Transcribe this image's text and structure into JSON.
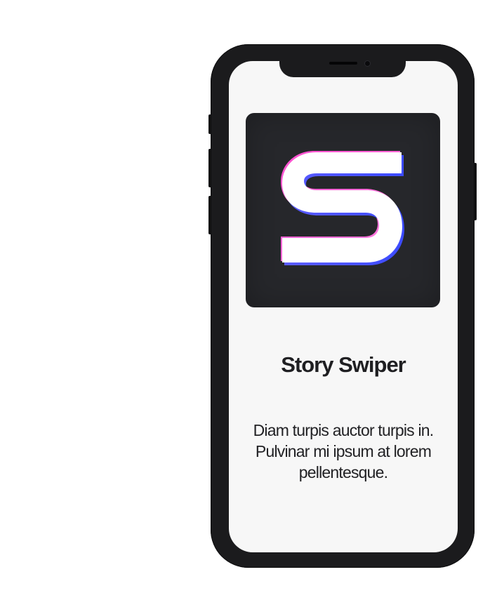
{
  "app": {
    "name": "Story Swiper",
    "description": "Diam turpis auctor turpis in. Pulvinar mi ipsum at lorem pellentesque.",
    "icon": "story-swiper-logo-icon"
  },
  "colors": {
    "phone_body": "#1b1b1d",
    "screen_background": "#f7f7f7",
    "icon_background": "#26272b",
    "logo_fill": "#ffffff",
    "gradient_pink": "#ff5fd2",
    "gradient_blue": "#4a5cff",
    "text": "#1f1f22"
  }
}
